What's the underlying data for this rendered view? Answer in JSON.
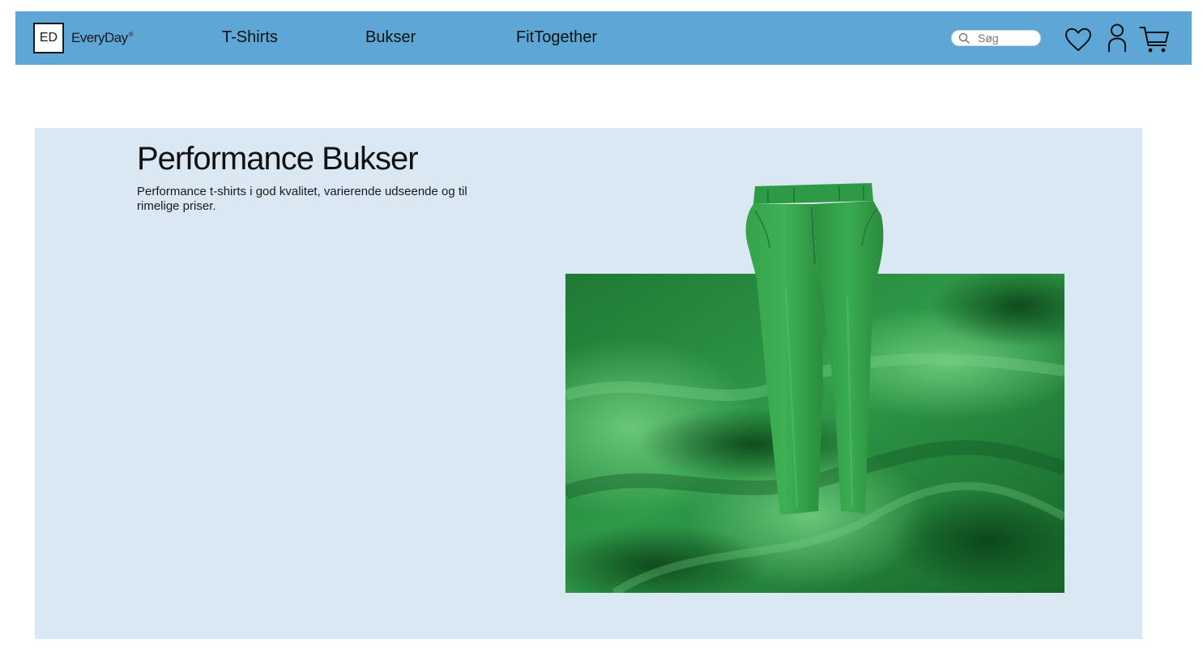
{
  "header": {
    "logo_mark": "ED",
    "logo_name": "EveryDay",
    "logo_trademark": "®",
    "nav": [
      {
        "label": "T-Shirts"
      },
      {
        "label": "Bukser"
      },
      {
        "label": "FitTogether"
      }
    ],
    "search": {
      "placeholder": "Søg",
      "icon": "search-icon"
    },
    "icons": [
      "heart-icon",
      "user-icon",
      "cart-icon"
    ],
    "colors": {
      "header_bg": "#5ea6d5",
      "hero_bg": "#d9e8f3",
      "product_green": "#2f9a48"
    }
  },
  "hero": {
    "title": "Performance Bukser",
    "description": "Performance t-shirts i god kvalitet, varierende udseende og til rimelige priser."
  }
}
